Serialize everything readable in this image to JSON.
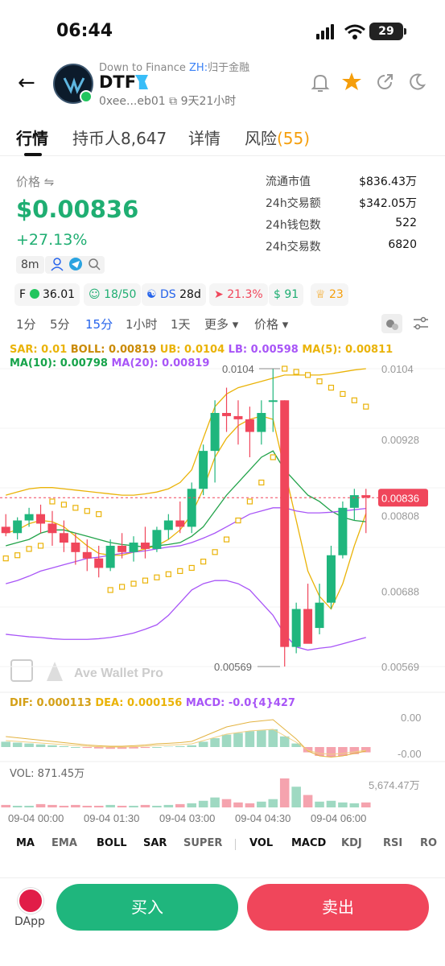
{
  "status": {
    "time": "06:44",
    "battery": "29"
  },
  "header": {
    "back_icon": "arrow-left-icon",
    "subtitle_prefix": "Down to Finance",
    "subtitle_zh": "ZH:",
    "subtitle_zh_name": "归于金融",
    "token": "DTF",
    "address": "0xee...eb01",
    "age": "9天21小时"
  },
  "tabs": [
    {
      "label": "行情"
    },
    {
      "label": "持币人8,647"
    },
    {
      "label": "详情"
    },
    {
      "label": "风险",
      "count": "(55)"
    }
  ],
  "price": {
    "label": "价格 ⇋",
    "value": "$0.00836",
    "change": "+27.13%",
    "tag": "8m"
  },
  "stats": [
    {
      "label": "流通市值",
      "value": "$836.43万"
    },
    {
      "label": "24h交易额",
      "value": "$342.05万"
    },
    {
      "label": "24h钱包数",
      "value": "522"
    },
    {
      "label": "24h交易数",
      "value": "6820"
    }
  ],
  "badges": [
    {
      "prefix": "F",
      "value": "36.01"
    },
    {
      "value": "18/50"
    },
    {
      "prefix": "DS",
      "value": "28d"
    },
    {
      "value": "21.3%"
    },
    {
      "value": "91"
    },
    {
      "value": "23"
    }
  ],
  "intervals": [
    "1分",
    "5分",
    "15分",
    "1小时",
    "1天",
    "更多 ▾",
    "价格 ▾"
  ],
  "indicators": {
    "sar": "SAR: 0.01",
    "boll": "BOLL: 0.00819",
    "ub": "UB: 0.0104",
    "lb": "LB: 0.00598",
    "ma5": "MA(5): 0.00811",
    "ma10": "MA(10): 0.00798",
    "ma20": "MA(20): 0.00819",
    "dif": "DIF: 0.000113",
    "dea": "DEA: 0.000156",
    "macd": "MACD: -0.0{4}427",
    "vol": "VOL: 871.45万"
  },
  "chart_labels": {
    "high_marker": "0.0104",
    "low_marker": "0.00569",
    "current_price": "0.00836",
    "y_ticks": [
      "0.0104",
      "0.00928",
      "0.00808",
      "0.00688",
      "0.00569"
    ],
    "macd_ticks": [
      "0.00",
      "-0.00"
    ],
    "vol_tick": "5,674.47万",
    "x_ticks": [
      "09-04 00:00",
      "09-04 01:30",
      "09-04 03:00",
      "09-04 04:30",
      "09-04 06:00"
    ],
    "watermark": "Ave Wallet Pro"
  },
  "indicator_tabs": [
    "MA",
    "EMA",
    "BOLL",
    "SAR",
    "SUPER",
    "VOL",
    "MACD",
    "KDJ",
    "RSI",
    "RO"
  ],
  "bottom": {
    "dapp": "DApp",
    "buy": "买入",
    "sell": "卖出"
  },
  "colors": {
    "up": "#1fb67d",
    "down": "#f0465b",
    "accent": "#2563eb"
  },
  "chart_data": {
    "type": "candlestick",
    "interval": "15分",
    "x_ticks": [
      "09-04 00:00",
      "09-04 01:30",
      "09-04 03:00",
      "09-04 04:30",
      "09-04 06:00"
    ],
    "y_ticks": [
      0.0104,
      0.00928,
      0.00808,
      0.00688,
      0.00569
    ],
    "ohlc": [
      [
        0.0079,
        0.0081,
        0.00775,
        0.0078
      ],
      [
        0.0078,
        0.00805,
        0.0077,
        0.008
      ],
      [
        0.008,
        0.0082,
        0.0079,
        0.0081
      ],
      [
        0.0081,
        0.00825,
        0.0078,
        0.00795
      ],
      [
        0.00795,
        0.00815,
        0.0076,
        0.0078
      ],
      [
        0.0078,
        0.008,
        0.0075,
        0.00765
      ],
      [
        0.00765,
        0.0078,
        0.0073,
        0.0075
      ],
      [
        0.0075,
        0.0077,
        0.0072,
        0.0074
      ],
      [
        0.0074,
        0.0076,
        0.0071,
        0.00725
      ],
      [
        0.00725,
        0.0077,
        0.0072,
        0.0076
      ],
      [
        0.0076,
        0.0078,
        0.0074,
        0.0075
      ],
      [
        0.0075,
        0.00775,
        0.00735,
        0.00765
      ],
      [
        0.00765,
        0.0079,
        0.0074,
        0.00755
      ],
      [
        0.00755,
        0.0079,
        0.0075,
        0.00785
      ],
      [
        0.00785,
        0.0081,
        0.0077,
        0.008
      ],
      [
        0.008,
        0.0083,
        0.0078,
        0.0079
      ],
      [
        0.0079,
        0.0086,
        0.0078,
        0.0085
      ],
      [
        0.0085,
        0.0092,
        0.0084,
        0.0091
      ],
      [
        0.0091,
        0.0099,
        0.0086,
        0.0097
      ],
      [
        0.0097,
        0.0101,
        0.0094,
        0.00965
      ],
      [
        0.00965,
        0.0099,
        0.0092,
        0.0096
      ],
      [
        0.0096,
        0.0098,
        0.009,
        0.0094
      ],
      [
        0.0094,
        0.0099,
        0.0092,
        0.0097
      ],
      [
        0.0099,
        0.0104,
        0.0094,
        0.0099
      ],
      [
        0.0099,
        0.0099,
        0.00569,
        0.006
      ],
      [
        0.006,
        0.0067,
        0.0059,
        0.0066
      ],
      [
        0.0066,
        0.007,
        0.0061,
        0.00605
      ],
      [
        0.0063,
        0.007,
        0.0062,
        0.0067
      ],
      [
        0.0067,
        0.0076,
        0.0066,
        0.00745
      ],
      [
        0.00745,
        0.0083,
        0.0074,
        0.0082
      ],
      [
        0.0082,
        0.0085,
        0.008,
        0.0084
      ],
      [
        0.0084,
        0.0085,
        0.0078,
        0.00836
      ]
    ],
    "ylim": [
      0.00569,
      0.0104
    ],
    "series": [
      {
        "name": "UB",
        "values": [
          0.0084,
          0.00845,
          0.0085,
          0.00852,
          0.00852,
          0.0085,
          0.00848,
          0.00846,
          0.00844,
          0.00842,
          0.0084,
          0.0084,
          0.00842,
          0.00845,
          0.0085,
          0.0086,
          0.0088,
          0.0093,
          0.0098,
          0.01,
          0.0101,
          0.01015,
          0.0102,
          0.01025,
          0.0103,
          0.0103,
          0.0103,
          0.0103,
          0.01032,
          0.01035,
          0.01038,
          0.0104
        ]
      },
      {
        "name": "LB",
        "values": [
          0.0062,
          0.00618,
          0.00616,
          0.00615,
          0.00613,
          0.00612,
          0.00612,
          0.00612,
          0.00613,
          0.00615,
          0.00618,
          0.00622,
          0.00628,
          0.00635,
          0.0065,
          0.0067,
          0.0069,
          0.007,
          0.00705,
          0.00705,
          0.007,
          0.0069,
          0.0067,
          0.0065,
          0.0062,
          0.006,
          0.00595,
          0.00598,
          0.006,
          0.00605,
          0.0061,
          0.00615
        ]
      },
      {
        "name": "MA(5)",
        "values": [
          0.0078,
          0.00785,
          0.00795,
          0.008,
          0.00798,
          0.0079,
          0.00775,
          0.0076,
          0.00748,
          0.00745,
          0.00745,
          0.0075,
          0.00755,
          0.0076,
          0.0077,
          0.00785,
          0.0081,
          0.0085,
          0.009,
          0.0093,
          0.0095,
          0.0096,
          0.00965,
          0.0096,
          0.0088,
          0.008,
          0.0072,
          0.0068,
          0.0066,
          0.007,
          0.0076,
          0.00811
        ]
      },
      {
        "name": "MA(10)",
        "values": [
          0.0076,
          0.00765,
          0.0077,
          0.0078,
          0.00785,
          0.00785,
          0.0078,
          0.00775,
          0.0077,
          0.00765,
          0.00762,
          0.0076,
          0.00758,
          0.0076,
          0.00762,
          0.00765,
          0.00775,
          0.0079,
          0.00815,
          0.0084,
          0.0086,
          0.0088,
          0.009,
          0.0091,
          0.0088,
          0.0086,
          0.0084,
          0.0083,
          0.00815,
          0.00805,
          0.008,
          0.00798
        ]
      },
      {
        "name": "MA(20)",
        "values": [
          0.007,
          0.00705,
          0.00712,
          0.0072,
          0.00725,
          0.0073,
          0.00735,
          0.0074,
          0.00742,
          0.00745,
          0.00748,
          0.0075,
          0.00752,
          0.00755,
          0.00758,
          0.0076,
          0.00765,
          0.00772,
          0.0078,
          0.0079,
          0.008,
          0.0081,
          0.00815,
          0.0082,
          0.0082,
          0.00815,
          0.00812,
          0.00812,
          0.00813,
          0.00815,
          0.00817,
          0.00819
        ]
      }
    ],
    "sar": [
      0.0074,
      0.00745,
      0.00755,
      0.0076,
      0.0083,
      0.00825,
      0.0082,
      0.00815,
      0.0081,
      0.0069,
      0.00695,
      0.007,
      0.00705,
      0.0071,
      0.00715,
      0.0072,
      0.00725,
      0.00735,
      0.0075,
      0.0077,
      0.008,
      0.0083,
      0.0086,
      0.009,
      0.0104,
      0.01035,
      0.0103,
      0.0102,
      0.0101,
      0.01,
      0.0099,
      0.0098
    ],
    "macd_hist": [
      0.3,
      0.25,
      0.2,
      0.15,
      0.1,
      0.05,
      0,
      -0.05,
      -0.08,
      -0.1,
      -0.1,
      -0.08,
      -0.05,
      0,
      0.02,
      0.05,
      0.1,
      0.3,
      0.5,
      0.7,
      0.8,
      0.9,
      0.95,
      1.0,
      0.6,
      0.2,
      -0.3,
      -0.5,
      -0.55,
      -0.5,
      -0.4,
      -0.3
    ],
    "volume": [
      0.3,
      0.2,
      0.2,
      0.4,
      0.3,
      0.2,
      0.3,
      0.2,
      0.2,
      0.3,
      0.2,
      0.2,
      0.3,
      0.2,
      0.3,
      0.4,
      0.5,
      0.8,
      1.2,
      1.0,
      0.6,
      0.5,
      0.7,
      1.0,
      3.5,
      2.5,
      1.5,
      0.7,
      0.8,
      0.6,
      0.5,
      0.6
    ]
  }
}
